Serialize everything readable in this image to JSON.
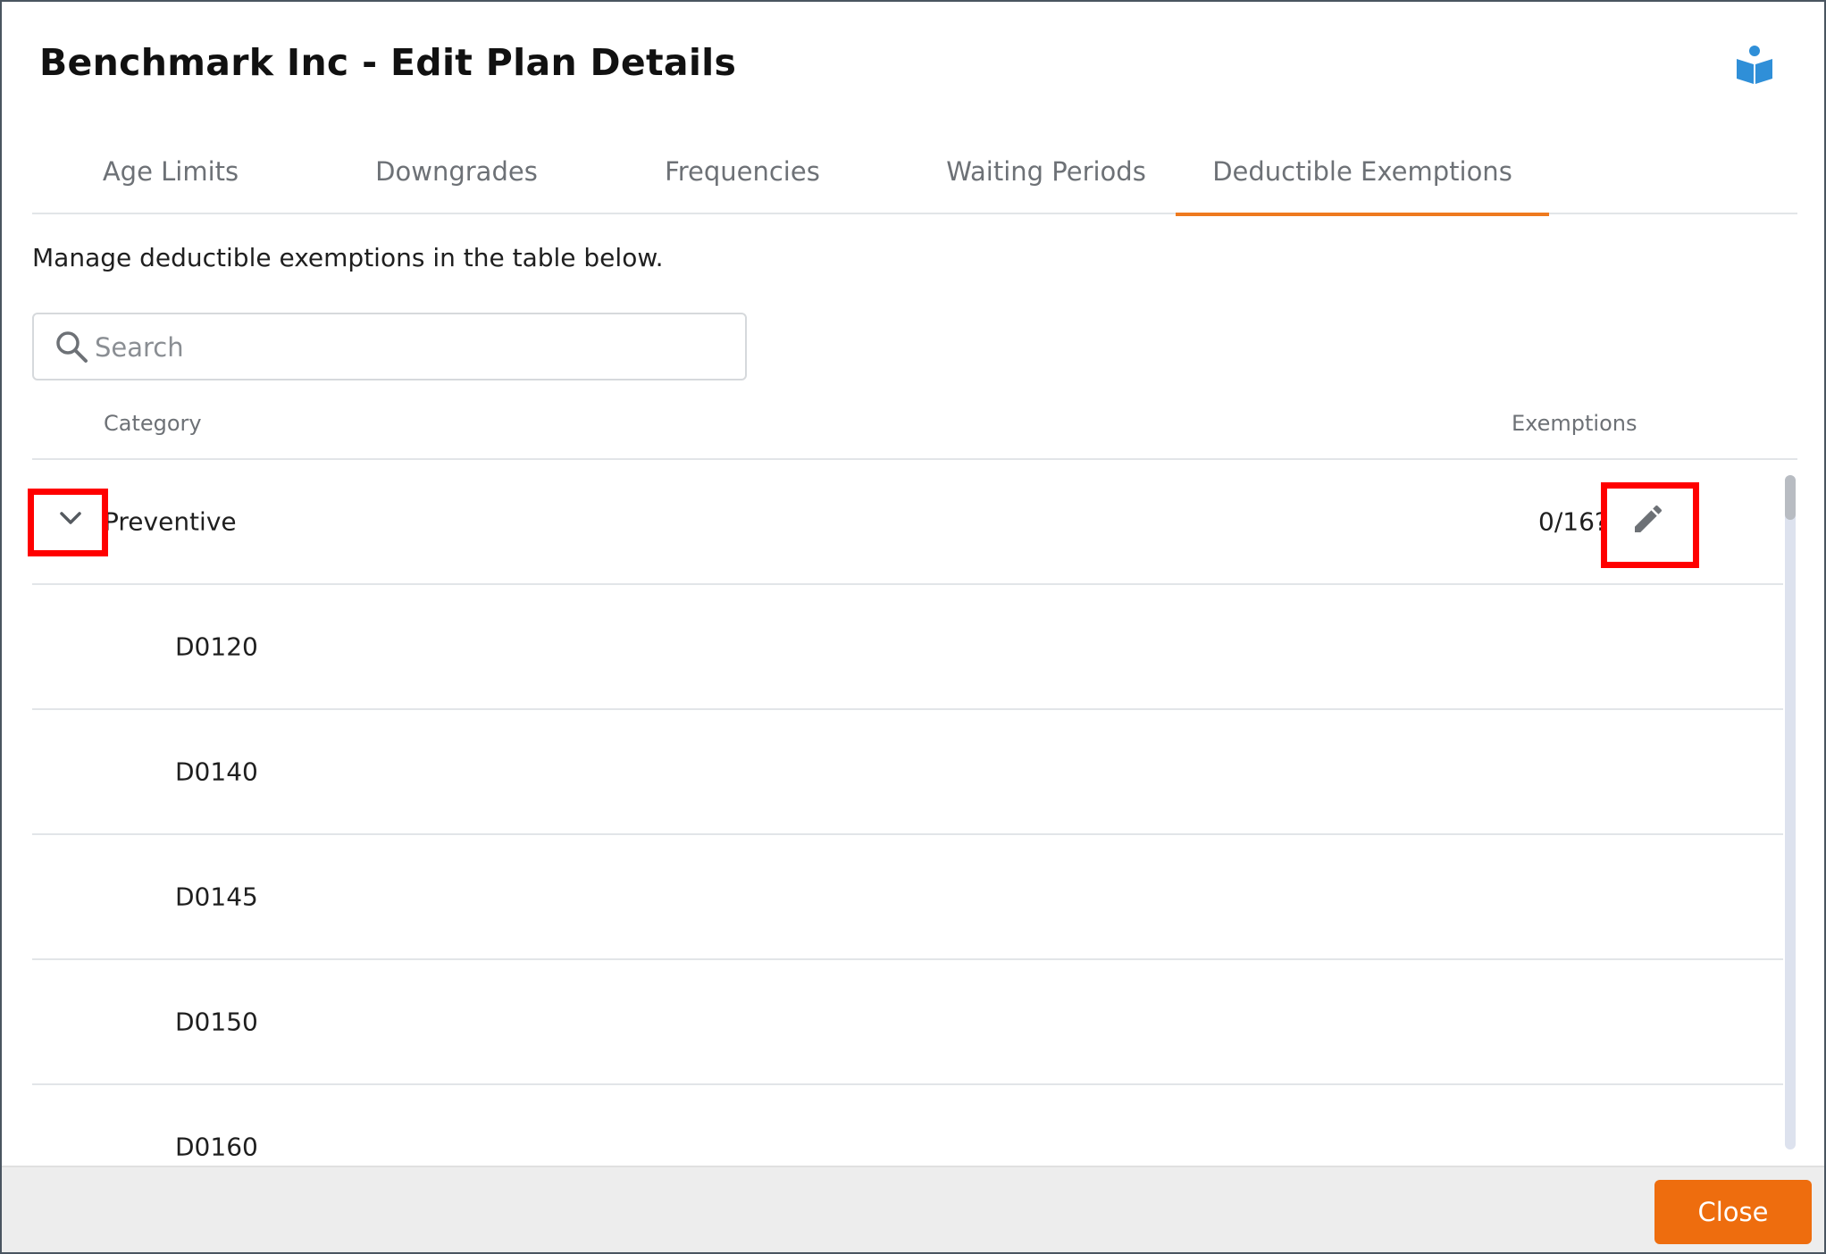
{
  "modal": {
    "title": "Benchmark Inc - Edit Plan Details",
    "help_icon": "book-reader-icon"
  },
  "tabs": [
    {
      "label": "Age Limits",
      "active": false
    },
    {
      "label": "Downgrades",
      "active": false
    },
    {
      "label": "Frequencies",
      "active": false
    },
    {
      "label": "Waiting Periods",
      "active": false
    },
    {
      "label": "Deductible Exemptions",
      "active": true
    }
  ],
  "description": "Manage deductible exemptions in the table below.",
  "search": {
    "placeholder": "Search",
    "value": ""
  },
  "table": {
    "columns": {
      "category": "Category",
      "exemptions": "Exemptions"
    },
    "group": {
      "label": "Preventive",
      "count": "0/16?",
      "expanded": true
    },
    "children": [
      "D0120",
      "D0140",
      "D0145",
      "D0150",
      "D0160"
    ]
  },
  "footer": {
    "close_label": "Close"
  },
  "colors": {
    "accent": "#ee7a1f",
    "button": "#ee6d0e",
    "highlight": "#ff0000",
    "icon_blue": "#2f8fd8"
  }
}
